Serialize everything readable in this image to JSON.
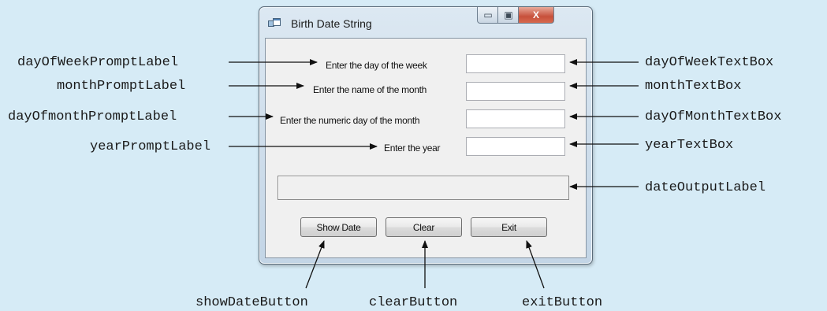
{
  "window": {
    "title": "Birth Date String",
    "controls": {
      "minimize": "▭",
      "maximize": "▣",
      "close": "X"
    }
  },
  "form": {
    "prompts": {
      "day_of_week": "Enter the day of the week",
      "month": "Enter the name of the month",
      "day_of_month": "Enter the numeric day of the month",
      "year": "Enter the year"
    },
    "inputs": {
      "day_of_week": "",
      "month": "",
      "day_of_month": "",
      "year": ""
    },
    "output": "",
    "buttons": {
      "show_date": "Show Date",
      "clear": "Clear",
      "exit": "Exit"
    }
  },
  "callouts": {
    "left": [
      "dayOfWeekPromptLabel",
      "monthPromptLabel",
      "dayOfmonthPromptLabel",
      "yearPromptLabel"
    ],
    "right": [
      "dayOfWeekTextBox",
      "monthTextBox",
      "dayOfMonthTextBox",
      "yearTextBox",
      "dateOutputLabel"
    ],
    "bottom": [
      "showDateButton",
      "clearButton",
      "exitButton"
    ]
  }
}
